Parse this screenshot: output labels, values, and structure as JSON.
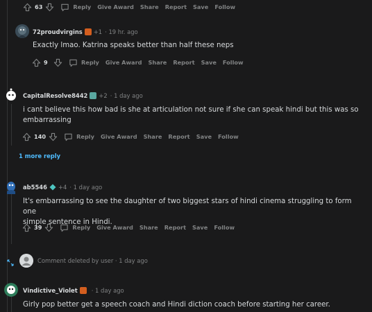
{
  "labels": {
    "reply": "Reply",
    "give_award": "Give Award",
    "share": "Share",
    "report": "Report",
    "save": "Save",
    "follow": "Follow"
  },
  "comments": [
    {
      "score": "63"
    },
    {
      "user": "72proudvirgins",
      "karma": "+1",
      "time": "· 19 hr. ago",
      "text": "Exactly lmao. Katrina speaks better than half these neps",
      "score": "9"
    },
    {
      "user": "CapitalResolve8442",
      "karma": "+2",
      "time": "· 1 day ago",
      "text_lines": [
        "i cant believe this how bad is she at articulation not sure if she can speak hindi but this was so",
        "embarrassing"
      ],
      "score": "140"
    },
    {
      "user": "ab5546",
      "karma": "+4",
      "time": "· 1 day ago",
      "text_lines": [
        "It's embarrassing to see the daughter of two biggest stars of hindi cinema struggling to form one",
        "simple sentence in Hindi."
      ],
      "score": "39"
    },
    {
      "user": "Vindictive_Violet",
      "time": "· 1 day ago",
      "text": "Girly pop better get a speech coach and Hindi diction coach before starting her career."
    }
  ],
  "more_replies": "1 more reply",
  "deleted_comment": "Comment deleted by user · 1 day ago",
  "colors": {
    "background": "#1a1a1b",
    "text": "#d7dadc",
    "muted": "#818384",
    "link": "#4fbcff",
    "thread_line": "#343536"
  }
}
